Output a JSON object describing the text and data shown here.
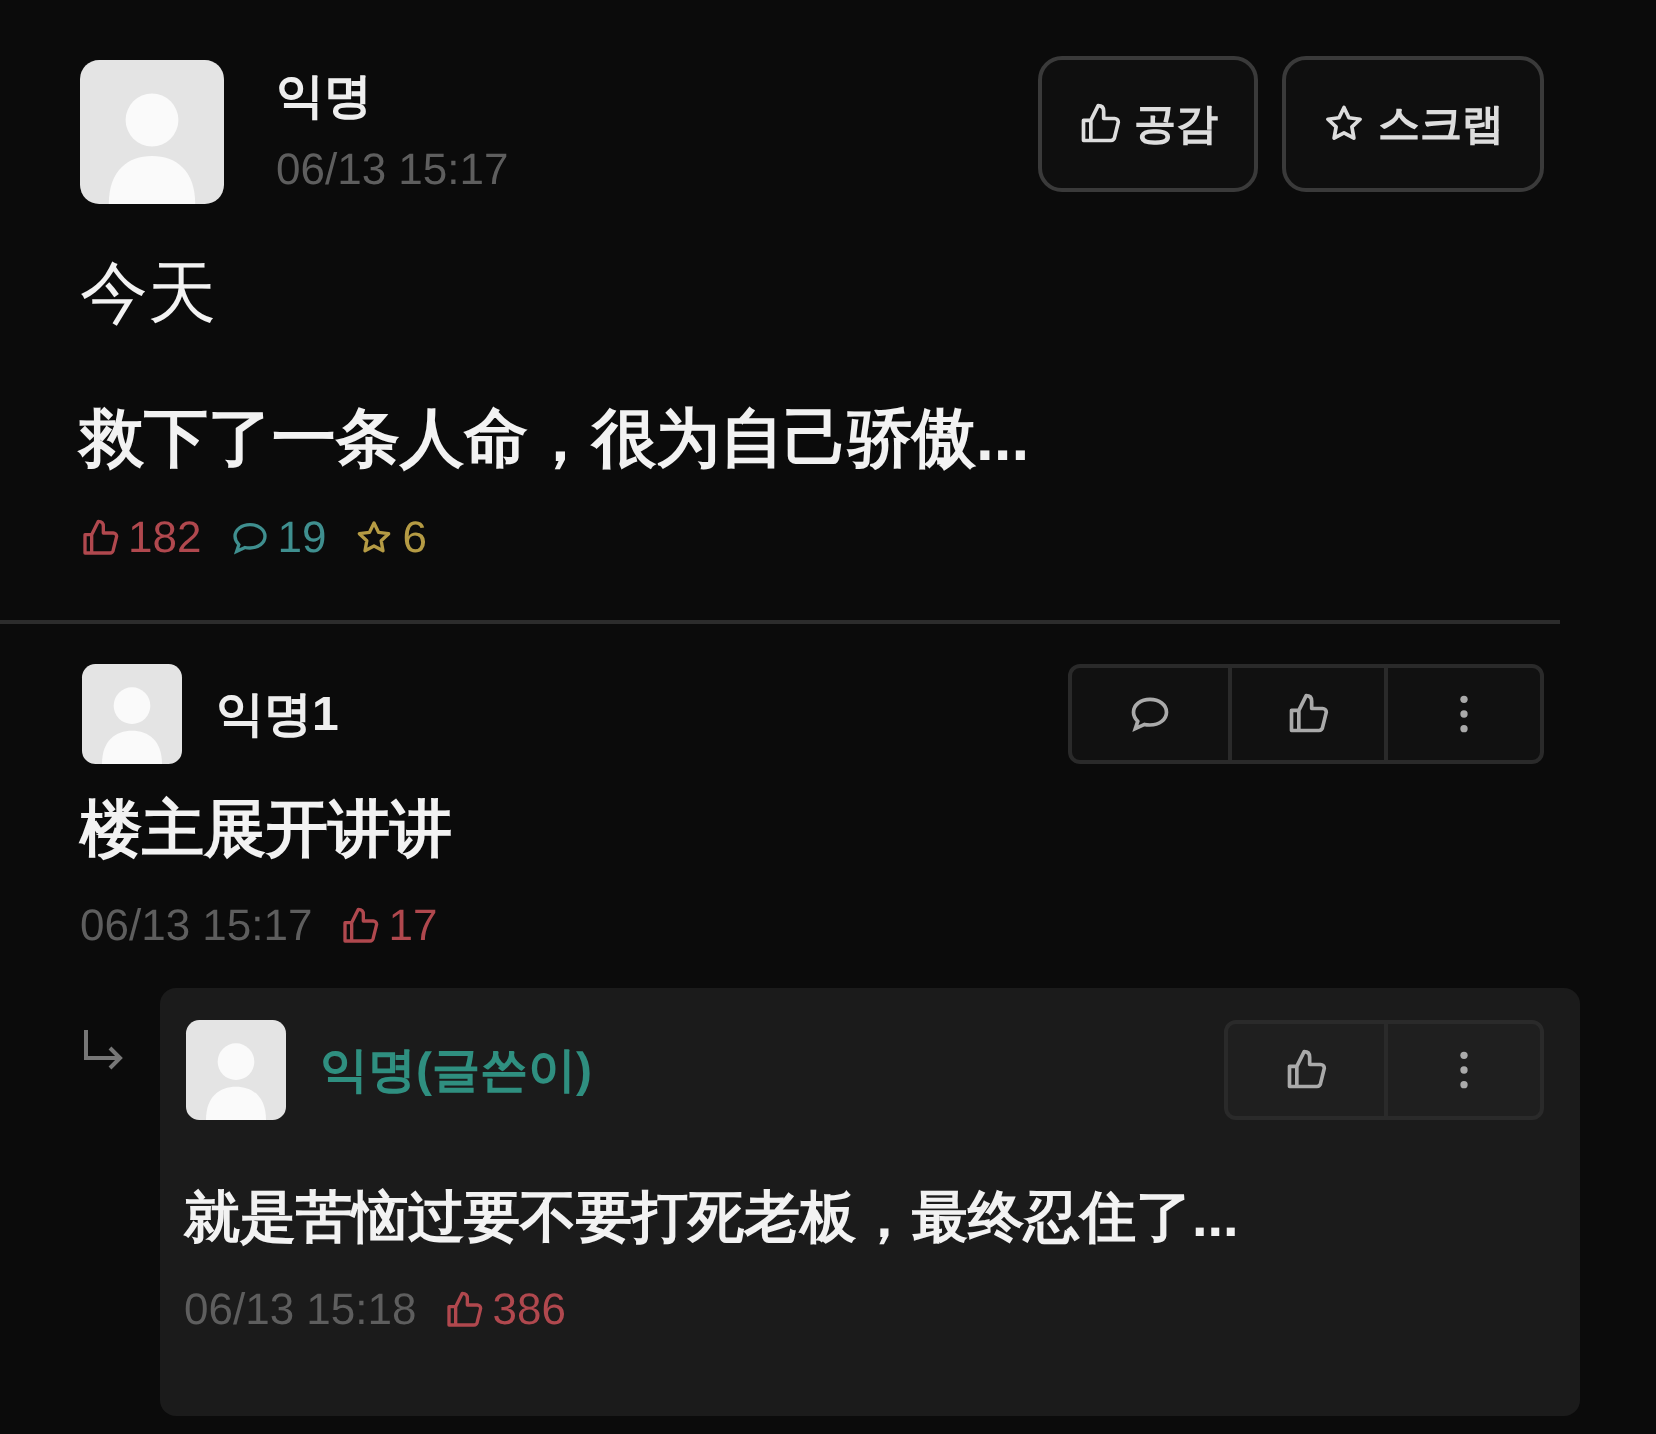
{
  "post": {
    "author": "익명",
    "time": "06/13 15:17",
    "buttons": [
      {
        "kind": "like",
        "label": "공감"
      },
      {
        "kind": "scrap",
        "label": "스크랩"
      }
    ],
    "title": "今天",
    "body": "救下了一条人命，很为自己骄傲...",
    "stats": [
      {
        "kind": "like",
        "value": "182"
      },
      {
        "kind": "comment",
        "value": "19"
      },
      {
        "kind": "scrap",
        "value": "6"
      }
    ]
  },
  "comments": [
    {
      "author": "익명1",
      "poster": false,
      "text": "楼主展开讲讲",
      "time": "06/13 15:17",
      "likes": "17",
      "replies": [
        {
          "author": "익명(글쓴이)",
          "poster": true,
          "text": "就是苦恼过要不要打死老板，最终忍住了...",
          "time": "06/13 15:18",
          "likes": "386"
        }
      ]
    }
  ]
}
